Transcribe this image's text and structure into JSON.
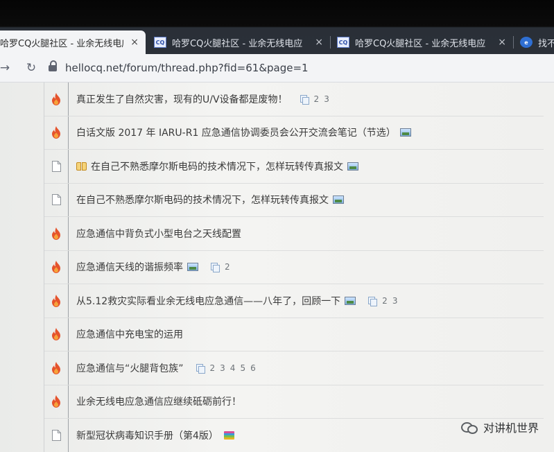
{
  "tabs": [
    {
      "favicon": "CQ",
      "title": "哈罗CQ火腿社区 - 业余无线电应",
      "close": "×"
    },
    {
      "favicon": "CQ",
      "title": "哈罗CQ火腿社区 - 业余无线电应",
      "close": "×"
    },
    {
      "favicon": "CQ",
      "title": "哈罗CQ火腿社区 - 业余无线电应",
      "close": "×"
    },
    {
      "favicon": "globe-icon",
      "title": "找不"
    }
  ],
  "toolbar": {
    "url": "hellocq.net/forum/thread.php?fid=61&page=1"
  },
  "threads": [
    {
      "icon": "flame-icon",
      "title": "真正发生了自然灾害，现有的U/V设备都是废物！",
      "pages": [
        "2",
        "3"
      ]
    },
    {
      "icon": "flame-icon",
      "title": "白话文版 2017 年 IARU-R1 应急通信协调委员会公开交流会笔记（节选）"
    },
    {
      "icon": "document-icon",
      "title": "在自己不熟悉摩尔斯电码的技术情况下，怎样玩转传真报文"
    },
    {
      "icon": "document-icon",
      "title": "在自己不熟悉摩尔斯电码的技术情况下，怎样玩转传真报文"
    },
    {
      "icon": "flame-icon",
      "title": "应急通信中背负式小型电台之天线配置"
    },
    {
      "icon": "flame-icon",
      "title": "应急通信天线的谐振频率",
      "pages": [
        "2"
      ]
    },
    {
      "icon": "flame-icon",
      "title": "从5.12救灾实际看业余无线电应急通信——八年了，回顾一下",
      "pages": [
        "2",
        "3"
      ]
    },
    {
      "icon": "flame-icon",
      "title": "应急通信中充电宝的运用"
    },
    {
      "icon": "flame-icon",
      "title": "应急通信与“火腿背包族”",
      "pages": [
        "2",
        "3",
        "4",
        "5",
        "6"
      ]
    },
    {
      "icon": "flame-icon",
      "title": "业余无线电应急通信应继续砥砺前行！"
    },
    {
      "icon": "document-icon",
      "title": "新型冠状病毒知识手册（第4版）"
    }
  ],
  "watermark": {
    "text": "对讲机世界"
  }
}
